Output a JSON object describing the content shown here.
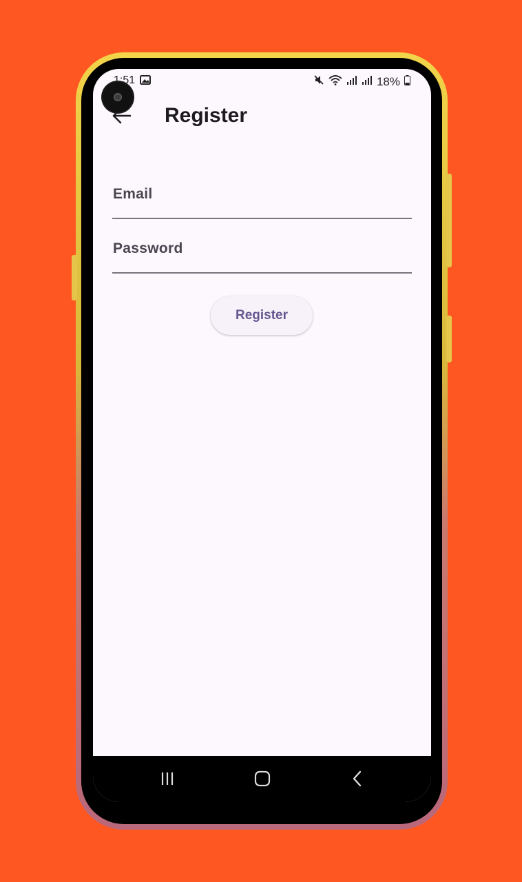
{
  "status_bar": {
    "time": "1:51",
    "battery": "18%",
    "icons": [
      "image-icon",
      "mute-icon",
      "wifi-icon",
      "signal-icon",
      "signal-icon",
      "battery-icon"
    ]
  },
  "app_bar": {
    "title": "Register",
    "back_icon": "arrow-left-icon"
  },
  "form": {
    "email_label": "Email",
    "email_value": "",
    "password_label": "Password",
    "password_value": "",
    "submit_label": "Register"
  },
  "nav_bar": {
    "items": [
      "recents-icon",
      "home-icon",
      "back-icon"
    ]
  },
  "colors": {
    "background": "#FF5722",
    "screen": "#FDF7FE",
    "button_text": "#65558F",
    "button_bg": "#F7F2FA"
  }
}
